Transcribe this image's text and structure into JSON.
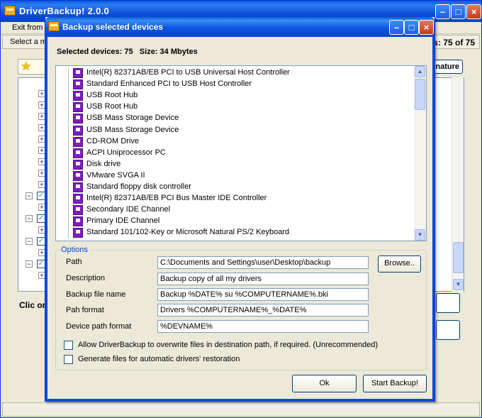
{
  "main_window": {
    "title": "DriverBackup! 2.0.0",
    "menu_item": "Exit from D",
    "status_left": "Select a mo",
    "status_right": "s: 75 of 75",
    "signature_button": "nature",
    "clic_text": "Clic or"
  },
  "dialog": {
    "title": "Backup selected devices",
    "selected_devices_label": "Selected devices: 75",
    "size_label": "Size: 34 Mbytes",
    "devices": [
      "Intel(R) 82371AB/EB PCI to USB Universal Host Controller",
      "Standard Enhanced PCI to USB Host Controller",
      "USB Root Hub",
      "USB Root Hub",
      "USB Mass Storage Device",
      "USB Mass Storage Device",
      "CD-ROM Drive",
      "ACPI Uniprocessor PC",
      "Disk drive",
      "VMware SVGA II",
      "Standard floppy disk controller",
      "Intel(R) 82371AB/EB PCI Bus Master IDE Controller",
      "Secondary IDE Channel",
      "Primary IDE Channel",
      "Standard 101/102-Key or Microsoft Natural PS/2 Keyboard"
    ],
    "options": {
      "legend": "Options",
      "path_label": "Path",
      "path_value": "C:\\Documents and Settings\\user\\Desktop\\backup",
      "browse_label": "Browse..",
      "description_label": "Description",
      "description_value": "Backup copy of all  my drivers",
      "backup_file_name_label": "Backup file name",
      "backup_file_name_value": "Backup %DATE% su %COMPUTERNAME%.bki",
      "path_format_label": "Pah format",
      "path_format_value": "Drivers %COMPUTERNAME%_%DATE%",
      "device_path_format_label": "Device path format",
      "device_path_format_value": "%DEVNAME%",
      "overwrite_label": "Allow DriverBackup to overwrite files in destination path, if required. (Unrecommended)",
      "overwrite_checked": false,
      "generate_label": "Generate files for automatic drivers' restoration",
      "generate_checked": false
    },
    "ok_label": "Ok",
    "start_label": "Start Backup!"
  }
}
